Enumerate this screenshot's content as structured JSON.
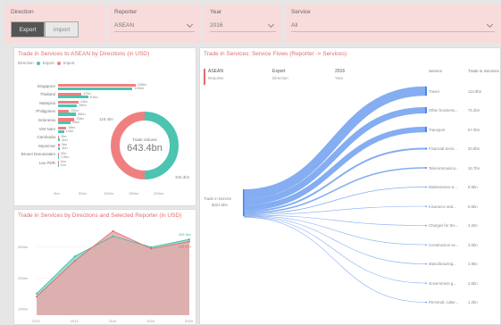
{
  "filters": {
    "direction": {
      "title": "Direction",
      "options": [
        "Export",
        "Import"
      ],
      "selected": "Export"
    },
    "reporter": {
      "title": "Reporter",
      "value": "ASEAN"
    },
    "year": {
      "title": "Year",
      "value": "2016"
    },
    "service": {
      "title": "Service",
      "value": "All"
    }
  },
  "bar_panel": {
    "title": "Trade in Services to ASEAN by Directions (in USD)",
    "legend_title": "Direction",
    "legend": [
      "Export",
      "Import"
    ],
    "donut_center_label": "Trade Volume",
    "donut_center_value": "643.4bn"
  },
  "area_panel": {
    "title": "Trade in Services by Directions and Selected Reporter (in USD)"
  },
  "sankey_panel": {
    "title": "Trade in Services: Service Flows (Reporter -> Services)",
    "header": [
      {
        "value": "ASEAN",
        "label": "Reporter"
      },
      {
        "value": "Export",
        "label": "Direction"
      },
      {
        "value": "2016",
        "label": "Year"
      }
    ],
    "source_label": "Trade in Service",
    "source_value": "$321.6bn",
    "col_service": "Service",
    "col_value": "Trade in Services"
  },
  "chart_data": [
    {
      "type": "bar",
      "categories": [
        "Singapore",
        "Thailand",
        "Malaysia",
        "Philippines",
        "Indonesia",
        "Viet Nam",
        "Cambodia",
        "Myanmar",
        "Brunei Darussalam",
        "Lao PDR"
      ],
      "series": [
        {
          "name": "Export",
          "values": [
            149,
            61,
            38,
            36,
            25,
            12,
            4,
            4,
            1.5,
            1
          ]
        },
        {
          "name": "Import",
          "values": [
            155,
            47,
            41,
            22,
            33,
            16,
            2,
            3,
            2,
            1
          ]
        }
      ],
      "xtick_labels": [
        "0bn",
        "50bn",
        "100bn",
        "150bn",
        "200bn"
      ],
      "xlim": [
        0,
        200
      ],
      "callout": "118.4bn",
      "callout2": "325.3bn",
      "colors": {
        "Export": "#4bc4b0",
        "Import": "#f08080"
      }
    },
    {
      "type": "pie",
      "categories": [
        "Export",
        "Import"
      ],
      "values": [
        321.6,
        321.8
      ],
      "center_label": "643.4bn",
      "colors": [
        "#4bc4b0",
        "#f08080"
      ]
    },
    {
      "type": "area",
      "x": [
        "2012",
        "2013",
        "2014",
        "2015",
        "2016"
      ],
      "series": [
        {
          "name": "Export",
          "values": [
            150,
            270,
            335,
            300,
            325
          ]
        },
        {
          "name": "Import",
          "values": [
            140,
            255,
            352,
            295,
            318
          ]
        }
      ],
      "ytick_labels": [
        "100bn",
        "200bn",
        "300bn"
      ],
      "ylim": [
        80,
        380
      ],
      "callouts": [
        "325.3bn",
        "318.1bn"
      ],
      "colors": {
        "Export": "#7fd3c3",
        "Import": "#e8a8a8"
      }
    },
    {
      "type": "sankey",
      "source": "Trade in Service",
      "services": [
        "Travel",
        "Other business...",
        "Transport",
        "Financial Servi...",
        "Telecommunica...",
        "Maintenance a...",
        "Insurance and...",
        "Charges for the...",
        "Construction se...",
        "Manufacturing...",
        "Government g...",
        "Personal, cultur..."
      ],
      "values": [
        "112.9bn",
        "75.2bn",
        "67.0bn",
        "20.8bn",
        "16.7bn",
        "8.5bn",
        "6.6bn",
        "4.2bn",
        "3.6bn",
        "2.9bn",
        "2.6bn",
        "1.2bn"
      ],
      "weights": [
        112.9,
        75.2,
        67.0,
        20.8,
        16.7,
        8.5,
        6.6,
        4.2,
        3.6,
        2.9,
        2.6,
        1.2
      ],
      "color": "#6f9ff0"
    }
  ]
}
